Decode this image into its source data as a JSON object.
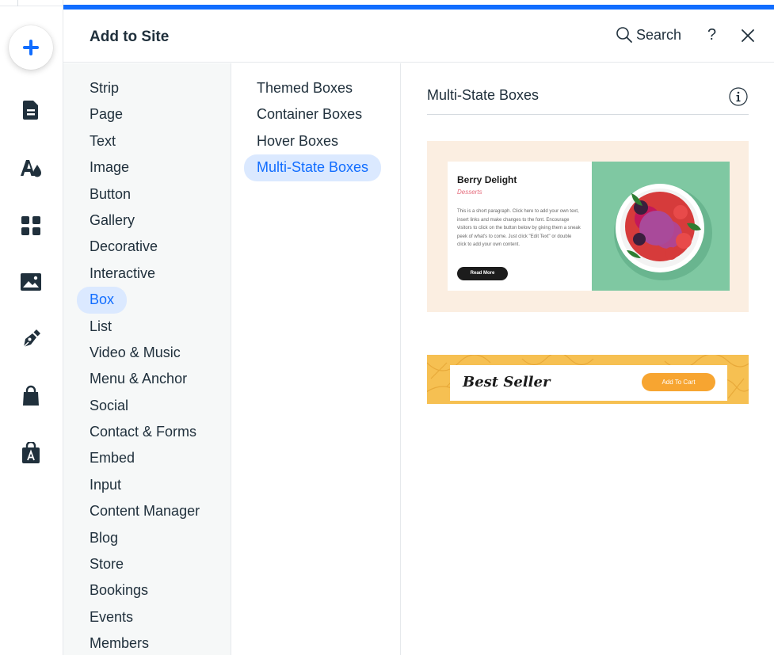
{
  "panel": {
    "title": "Add to Site",
    "search_label": "Search",
    "help_label": "?"
  },
  "rail": {
    "items": [
      {
        "icon": "plus-icon"
      },
      {
        "icon": "page-icon"
      },
      {
        "icon": "theme-icon"
      },
      {
        "icon": "apps-icon"
      },
      {
        "icon": "media-icon"
      },
      {
        "icon": "pen-icon"
      },
      {
        "icon": "store-bag-icon"
      },
      {
        "icon": "market-icon"
      }
    ]
  },
  "categories": [
    {
      "label": "Strip"
    },
    {
      "label": "Page"
    },
    {
      "label": "Text"
    },
    {
      "label": "Image"
    },
    {
      "label": "Button"
    },
    {
      "label": "Gallery"
    },
    {
      "label": "Decorative"
    },
    {
      "label": "Interactive"
    },
    {
      "label": "Box",
      "active": true
    },
    {
      "label": "List"
    },
    {
      "label": "Video & Music"
    },
    {
      "label": "Menu & Anchor"
    },
    {
      "label": "Social"
    },
    {
      "label": "Contact & Forms"
    },
    {
      "label": "Embed"
    },
    {
      "label": "Input"
    },
    {
      "label": "Content Manager"
    },
    {
      "label": "Blog"
    },
    {
      "label": "Store"
    },
    {
      "label": "Bookings"
    },
    {
      "label": "Events"
    },
    {
      "label": "Members"
    }
  ],
  "subcategories": [
    {
      "label": "Themed Boxes"
    },
    {
      "label": "Container Boxes"
    },
    {
      "label": "Hover Boxes"
    },
    {
      "label": "Multi-State Boxes",
      "active": true
    }
  ],
  "section": {
    "title": "Multi-State Boxes",
    "preview1": {
      "heading": "Berry Delight",
      "subheading": "Desserts",
      "paragraph": "This is a short paragraph. Click here to add your own text, insert links and make changes to the font. Encourage visitors to click on the button below by giving them a sneak peek of what's to come. Just click \"Edit Text\" or double click to add your own content.",
      "button": "Read More"
    },
    "preview2": {
      "text": "Best Seller",
      "button": "Add To Cart"
    }
  },
  "colors": {
    "accent": "#116dff",
    "active_bg": "#dbe9ff",
    "text": "#20303c"
  }
}
